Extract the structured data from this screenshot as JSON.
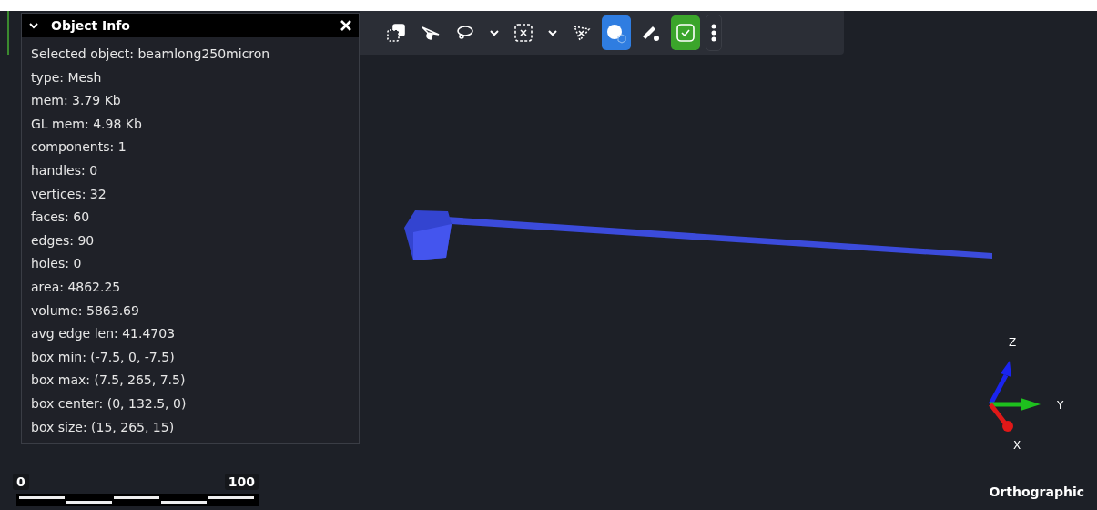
{
  "panel": {
    "title": "Object Info",
    "expanded": true,
    "lines": [
      "Selected object: beamlong250micron",
      "type: Mesh",
      "mem: 3.79 Kb",
      "GL mem: 4.98 Kb",
      "components: 1",
      "handles: 0",
      "vertices: 32",
      "faces: 60",
      "edges: 90",
      "holes: 0",
      "area: 4862.25",
      "volume: 5863.69",
      "avg edge len: 41.4703",
      "box min: (-7.5, 0, -7.5)",
      "box max: (7.5, 265, 7.5)",
      "box center: (0, 132.5, 0)",
      "box size: (15, 265, 15)"
    ]
  },
  "toolbar": [
    {
      "kind": "duplicate",
      "selected": false
    },
    {
      "kind": "plane",
      "selected": false
    },
    {
      "kind": "lasso",
      "selected": false
    },
    {
      "kind": "dropdown",
      "selected": false
    },
    {
      "kind": "box-select",
      "selected": false
    },
    {
      "kind": "dropdown",
      "selected": false
    },
    {
      "kind": "triangle",
      "selected": false
    },
    {
      "kind": "sphere",
      "selected": true
    },
    {
      "kind": "ruler",
      "selected": false
    },
    {
      "kind": "check",
      "selected": true
    }
  ],
  "scale_bar": {
    "start": "0",
    "end": "100"
  },
  "axes": {
    "x": "X",
    "y": "Y",
    "z": "Z"
  },
  "projection": "Orthographic"
}
